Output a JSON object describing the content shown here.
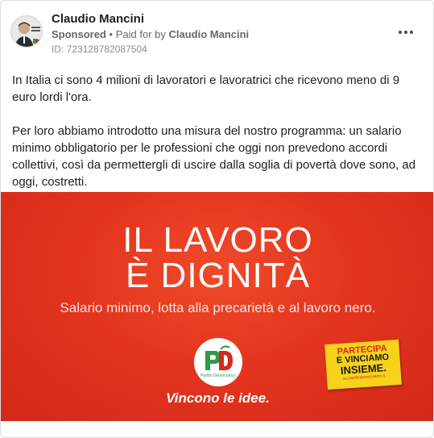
{
  "post": {
    "author": "Claudio Mancini",
    "sponsored_label": "Sponsored",
    "separator": "•",
    "paid_for_label": "Paid for by",
    "payer": "Claudio Mancini",
    "ad_id": "ID: 723128782087504",
    "more_icon": "more-horizontal-icon",
    "paragraphs": [
      "In Italia ci sono 4 milioni di lavoratori e lavoratrici che ricevono meno di 9 euro lordi l'ora.",
      "Per loro abbiamo introdotto una misura del nostro programma: un salario minimo obbligatorio per le professioni che oggi non prevedono accordi collettivi, così da permettergli di uscire dalla soglia di povertà dove sono, ad oggi, costretti."
    ],
    "ellipsis": "..."
  },
  "creative": {
    "headline_line1": "IL LAVORO",
    "headline_line2": "È DIGNITÀ",
    "tagline": "Salario minimo, lotta alla precarietà e al lavoro nero.",
    "logo_text": "Partito Democratico",
    "slogan": "Vincono le idee.",
    "sticker_line1": "PARTECIPA",
    "sticker_line2": "E VINCIAMO",
    "sticker_line3": "INSIEME.",
    "sticker_url": "su partitodemocratico.it",
    "colors": {
      "background": "#e3351e",
      "text": "#ffffff",
      "sticker": "#f6d31a",
      "logo_green": "#2e9b48",
      "logo_red": "#d6281b"
    }
  }
}
